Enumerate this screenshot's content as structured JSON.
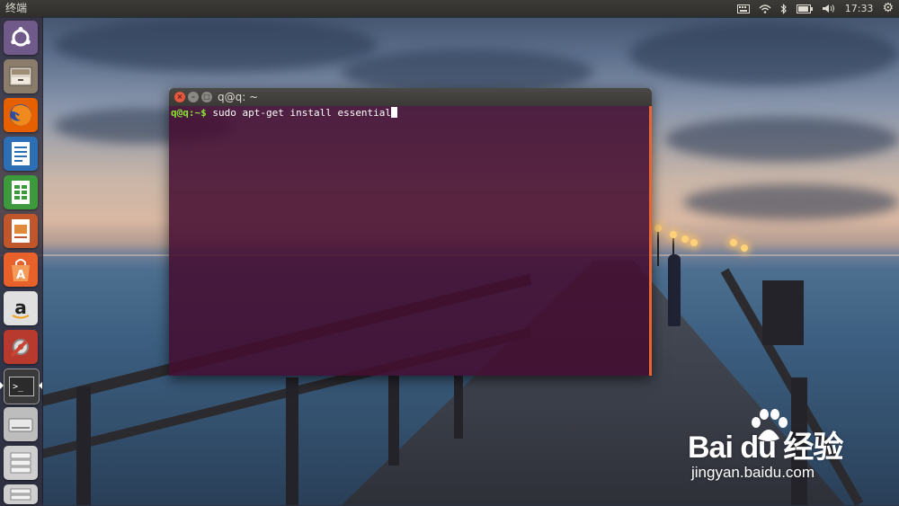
{
  "top_panel": {
    "title": "终端",
    "time": "17:33",
    "indicators": [
      "keyboard-icon",
      "wifi-icon",
      "bluetooth-icon",
      "battery-icon",
      "volume-icon"
    ]
  },
  "launcher": {
    "items": [
      {
        "name": "dash",
        "icon": "ubuntu-logo-icon",
        "color": "#6f5a8a"
      },
      {
        "name": "files",
        "icon": "file-cabinet-icon",
        "color": "#8b7d6b"
      },
      {
        "name": "firefox",
        "icon": "firefox-icon",
        "color": "#e66000"
      },
      {
        "name": "writer",
        "icon": "document-icon",
        "color": "#2c6fb5"
      },
      {
        "name": "calc",
        "icon": "spreadsheet-icon",
        "color": "#3c9a3c"
      },
      {
        "name": "impress",
        "icon": "presentation-icon",
        "color": "#c0562b"
      },
      {
        "name": "software-center",
        "icon": "shopping-bag-icon",
        "color": "#e8612a"
      },
      {
        "name": "amazon",
        "icon": "amazon-icon",
        "color": "#e0e0e0"
      },
      {
        "name": "settings",
        "icon": "tools-icon",
        "color": "#b83a2e"
      },
      {
        "name": "terminal",
        "icon": "terminal-icon",
        "color": "#3a3a3a"
      },
      {
        "name": "drive",
        "icon": "disk-icon",
        "color": "#bdbdbd"
      },
      {
        "name": "workspaces",
        "icon": "stack-icon",
        "color": "#cfcfcf"
      }
    ]
  },
  "terminal": {
    "window_title": "q@q: ~",
    "prompt": "q@q:~$",
    "command": " sudo apt-get install essential"
  },
  "watermark": {
    "logo": "Bai du 经验",
    "url": "jingyan.baidu.com"
  }
}
